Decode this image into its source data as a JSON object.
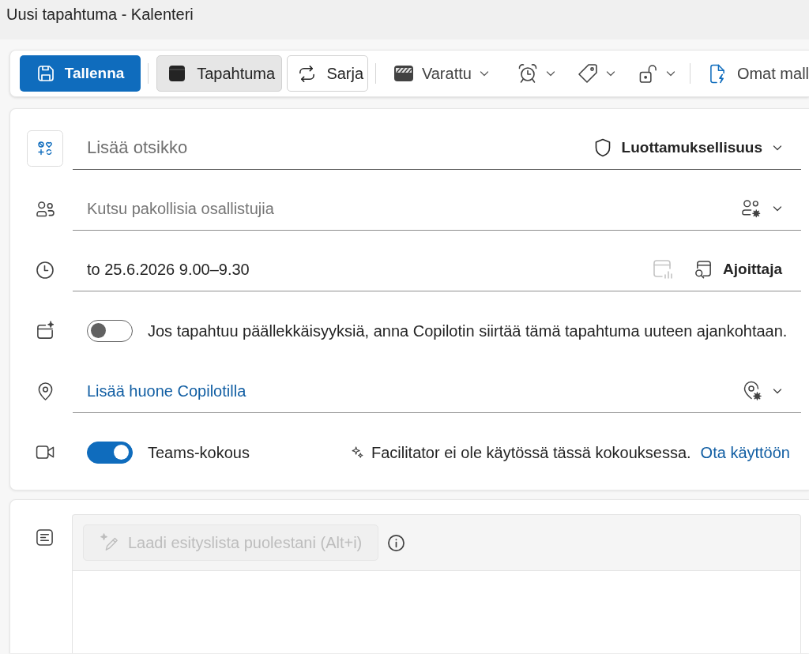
{
  "window": {
    "title": "Uusi tapahtuma - Kalenteri"
  },
  "toolbar": {
    "save": {
      "label": "Tallenna"
    },
    "event": {
      "label": "Tapahtuma",
      "selected": true
    },
    "series": {
      "label": "Sarja",
      "selected": false
    },
    "show_as": {
      "label": "Varattu"
    },
    "templates": {
      "label": "Omat mall"
    }
  },
  "form": {
    "title": {
      "placeholder": "Lisää otsikko"
    },
    "sensitivity": {
      "label": "Luottamuksellisuus"
    },
    "attendees": {
      "placeholder": "Kutsu pakollisia osallistujia"
    },
    "time": {
      "value": "to 25.6.2026 9.00–9.30",
      "insights": {
        "disabled": true
      },
      "scheduler_label": "Ajoittaja"
    },
    "copilot_reschedule": {
      "on": false,
      "label": "Jos tapahtuu päällekkäisyyksiä, anna Copilotin siirtää tämä tapahtuma uuteen ajankohtaan."
    },
    "location": {
      "link": "Lisää huone Copilotilla"
    },
    "teams_meeting": {
      "on": true,
      "label": "Teams-kokous",
      "facilitator_note": "Facilitator ei ole käytössä tässä kokouksessa.",
      "enable_link": "Ota käyttöön"
    }
  },
  "notes": {
    "agenda_button": {
      "label": "Laadi esityslista puolestani (Alt+i)",
      "disabled": true
    }
  }
}
